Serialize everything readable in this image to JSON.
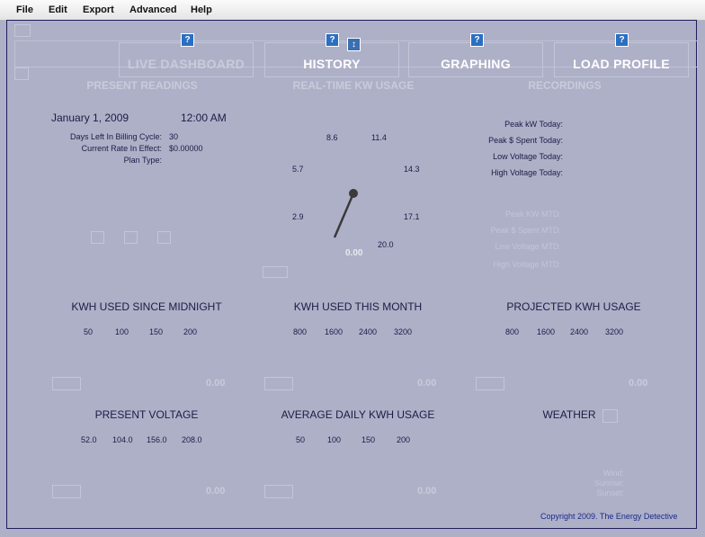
{
  "menu": [
    "File",
    "Edit",
    "Export",
    "Advanced",
    "Help"
  ],
  "tabs": [
    {
      "label": "LIVE DASHBOARD",
      "faded": true
    },
    {
      "label": "HISTORY",
      "faded": false
    },
    {
      "label": "GRAPHING",
      "faded": false
    },
    {
      "label": "LOAD PROFILE",
      "faded": false
    }
  ],
  "help_glyph": "?",
  "sections": {
    "present": "PRESENT READINGS",
    "realtime": "REAL-TIME KW USAGE",
    "recordings": "RECORDINGS"
  },
  "present": {
    "date": "January 1, 2009",
    "time": "12:00 AM",
    "days_left_label": "Days Left In Billing Cycle:",
    "days_left_value": "30",
    "rate_label": "Current Rate In Effect:",
    "rate_value": "$0.00000",
    "plan_label": "Plan Type:"
  },
  "gauge": {
    "ticks": [
      "2.9",
      "5.7",
      "8.6",
      "11.4",
      "14.3",
      "17.1",
      "20.0"
    ],
    "value": "0.00"
  },
  "recordings": {
    "today": [
      "Peak kW Today:",
      "Peak $ Spent Today:",
      "Low Voltage Today:",
      "High Voltage Today:"
    ],
    "mtd": [
      "Peak KW MTD:",
      "Peak $ Spent MTD:",
      "Low Voltage MTD:",
      "High Voltage MTD:"
    ]
  },
  "panels": [
    {
      "title": "KWH USED SINCE MIDNIGHT",
      "scale": [
        "50",
        "100",
        "150",
        "200"
      ],
      "value": "0.00"
    },
    {
      "title": "KWH USED THIS MONTH",
      "scale": [
        "800",
        "1600",
        "2400",
        "3200"
      ],
      "value": "0.00"
    },
    {
      "title": "PROJECTED KWH USAGE",
      "scale": [
        "800",
        "1600",
        "2400",
        "3200"
      ],
      "value": "0.00"
    },
    {
      "title": "PRESENT VOLTAGE",
      "scale": [
        "52.0",
        "104.0",
        "156.0",
        "208.0"
      ],
      "value": "0.00"
    },
    {
      "title": "AVERAGE DAILY KWH USAGE",
      "scale": [
        "50",
        "100",
        "150",
        "200"
      ],
      "value": "0.00"
    },
    {
      "title": "WEATHER"
    }
  ],
  "weather": {
    "wind": "Wind:",
    "sunrise": "Sunrise:",
    "sunset": "Sunset:"
  },
  "copyright": "Copyright 2009. The Energy Detective"
}
